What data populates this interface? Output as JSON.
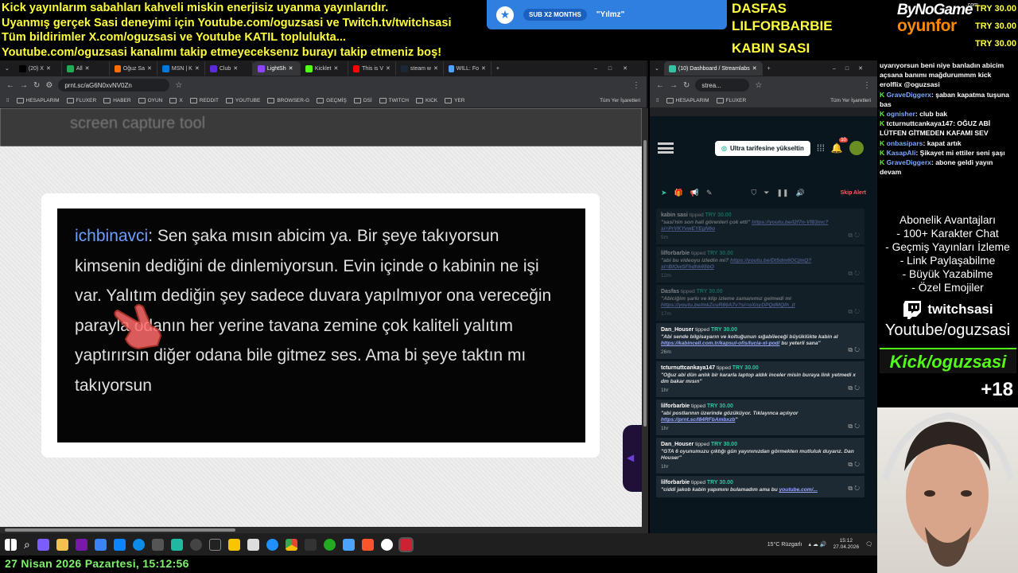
{
  "ticker": {
    "lines": [
      "Kick yayınlarım sabahları kahveli miskin enerjisiz uyanma yayınlarıdır.",
      "Uyanmış gerçek Sasi deneyimi için Youtube.com/oguzsasi ve Twitch.tv/twitchsasi",
      "Tüm bildirimler X.com/oguzsasi ve Youtube KATIL toplulukta...",
      "Youtube.com/oguzsasi kanalımı takip etmeyeceksenız burayı takip etmeniz boş!"
    ]
  },
  "sub_alert": {
    "badge": "SUB X2 MONTHS",
    "quote": "\"Yılmz\""
  },
  "top_donors": {
    "names": [
      "DASFAS",
      "LILFORBARBIE",
      "KABIN SASI"
    ],
    "amounts": [
      "TRY 30.00",
      "TRY 30.00",
      "TRY 30.00"
    ]
  },
  "logo": {
    "top": "ByNoGame",
    "com": ".com",
    "bottom": "oyunfor"
  },
  "browser_left": {
    "tabs": [
      {
        "label": "(20) X",
        "color": "#000000"
      },
      {
        "label": "All",
        "color": "#22aa55"
      },
      {
        "label": "Oğuz Sa",
        "color": "#ff6d00"
      },
      {
        "label": "MSN | K",
        "color": "#0078d4"
      },
      {
        "label": "Club",
        "color": "#5b2bd6"
      },
      {
        "label": "LightSh",
        "color": "#8e44ff"
      },
      {
        "label": "Kicklet",
        "color": "#53fc18"
      },
      {
        "label": "This is V",
        "color": "#ff0000"
      },
      {
        "label": "steam w",
        "color": "#1b2838"
      },
      {
        "label": "WILL: Fo",
        "color": "#4aa3ff"
      }
    ],
    "url": "prnt.sc/aG6N0xvNV0Zn",
    "bookmarks": [
      "HESAPLARIM",
      "FLUXER",
      "HABER",
      "OYUN",
      "X",
      "REDDIT",
      "YOUTUBE",
      "BROWSER-G",
      "GEÇMİŞ",
      "DSİ",
      "TWITCH",
      "KICK",
      "YER"
    ],
    "all_bookmarks": "Tüm Yer İşaretleri",
    "page_header": "screen capture tool",
    "shot": {
      "user": "ichbinavci",
      "text": ": Sen şaka mısın abicim ya. Bir şeye takıyorsun kimsenin dediğini de dinlemiyorsun. Evin içinde o kabinin ne işi var. Yalıtım dediğin şey sadece duvara yapılmıyor ona vereceğin parayla odanın her yerine tavana zemine çok kaliteli yalıtım yaptırırsın diğer odana bile gitmez ses. Ama bi şeye taktın mı takıyorsun"
    }
  },
  "browser_right": {
    "tab": "(10) Dashboard / Streamlabs",
    "url": "strea...",
    "bookmarks": [
      "HESAPLARIM",
      "FLUXER"
    ],
    "all_bookmarks": "Tüm Yer İşaretleri",
    "upgrade": "Ultra tarifesine yükseltin",
    "notif_count": "10",
    "skip": "Skip Alert",
    "events": [
      {
        "who": "kabin sasi",
        "amt": "TRY 30.00",
        "msg": "\"sasi'nin son hali görenleri çok etti\"",
        "link": "https://youtu.be/I2f7n-Vf83mc?si=PrVKYvwEYEgN6o",
        "time": "5m",
        "dim": true
      },
      {
        "who": "lilforbarbie",
        "amt": "TRY 30.00",
        "msg": "\"abi bu videoyu izledin mi?",
        "link": "https://youtu.be/Dt5dm6OCjmQ?si=BlOwSFhdhk65bO",
        "time": "12m",
        "dim": true
      },
      {
        "who": "Dasfas",
        "amt": "TRY 30.00",
        "msg": "\"Abiciğim şarkı ve klip izleme zamanımız gelmedi mi",
        "link": "https://youtu.be/mkZcuR86A7v?si=oXnyDPQdMQlh_jt",
        "time": "17m",
        "dim": true
      },
      {
        "who": "Dan_Houser",
        "amt": "TRY 30.00",
        "msg": "\"Abi sende bilgisayarın ve koltuğunun sığabileceği büyüklükte kabin al",
        "link": "https://kabincell.com.tr/kapsul-ofis/lucia-xl-pod/",
        "tail": " bu yeterli sana\"",
        "time": "26m",
        "dim": false
      },
      {
        "who": "tcturnuttcankaya147",
        "amt": "TRY 30.00",
        "msg": "\"Oğuz abi dün anlık bir kararla laptop aldık inceler misin buraya link yetmedi x dm bakar mısın\"",
        "link": "",
        "time": "1hr",
        "dim": false
      },
      {
        "who": "lilforbarbie",
        "amt": "TRY 30.00",
        "msg": "\"abi postlarının üzerinde gözüküyor. Tıklayınca açılıyor",
        "link": "https://prnt.sc/l84RFbAmbxzb",
        "tail": "\"",
        "time": "1hr",
        "dim": false
      },
      {
        "who": "Dan_Houser",
        "amt": "TRY 30.00",
        "msg": "\"GTA 6 oyunumuzu çıktığı gün yayınınızdan görmekten mutluluk duyarız. Dan Houser\"",
        "link": "",
        "time": "1hr",
        "dim": false
      },
      {
        "who": "lilforbarbie",
        "amt": "TRY 30.00",
        "msg": "\"ciddi jakob kabin yapımını bulamadım ama bu",
        "link": "youtube.com/...",
        "time": "",
        "dim": false
      }
    ],
    "tipped": "tipped"
  },
  "chat": [
    {
      "user": "",
      "text": "uyarıyorsun beni niye banladın abicim açsana banımı mağdurummm kick",
      "color": "#ffffff"
    },
    {
      "user": "",
      "text": "eroIflix @oguzsasi",
      "color": "#ffffff"
    },
    {
      "user": "GraveDiggerx",
      "text": ": şaban kapatma tuşuna bas",
      "color": "#7aa8ff"
    },
    {
      "user": "ognisher",
      "text": ": club bak",
      "color": "#7aa8ff"
    },
    {
      "user": "tcturnuttcankaya147",
      "text": ": OĞUZ ABİ LÜTFEN GİTMEDEN KAFAMI SEV",
      "color": "#ffffff"
    },
    {
      "user": "onbasipars",
      "text": ": kapat artık",
      "color": "#7aa8ff"
    },
    {
      "user": "KasapAli",
      "text": ": Şikayet mi ettiler seni şaşı",
      "color": "#7aa8ff"
    },
    {
      "user": "GraveDiggerx",
      "text": ": abone geldi yayın devam",
      "color": "#7aa8ff"
    }
  ],
  "perks": {
    "title": "Abonelik Avantajları",
    "items": [
      "- 100+ Karakter Chat",
      "- Geçmiş Yayınları İzleme",
      "- Link Paylaşabilme",
      "- Büyük Yazabilme",
      "- Özel Emojiler"
    ]
  },
  "socials": {
    "twitch": "twitchsasi",
    "youtube": "Youtube/oguzsasi",
    "kick": "Kick/oguzsasi",
    "age": "+18"
  },
  "taskbar": {
    "weather": "15°C  Rüzgarlı",
    "time": "15:12",
    "date": "27.04.2026"
  },
  "datebar": "27 Nisan 2026 Pazartesi, 15:12:56"
}
